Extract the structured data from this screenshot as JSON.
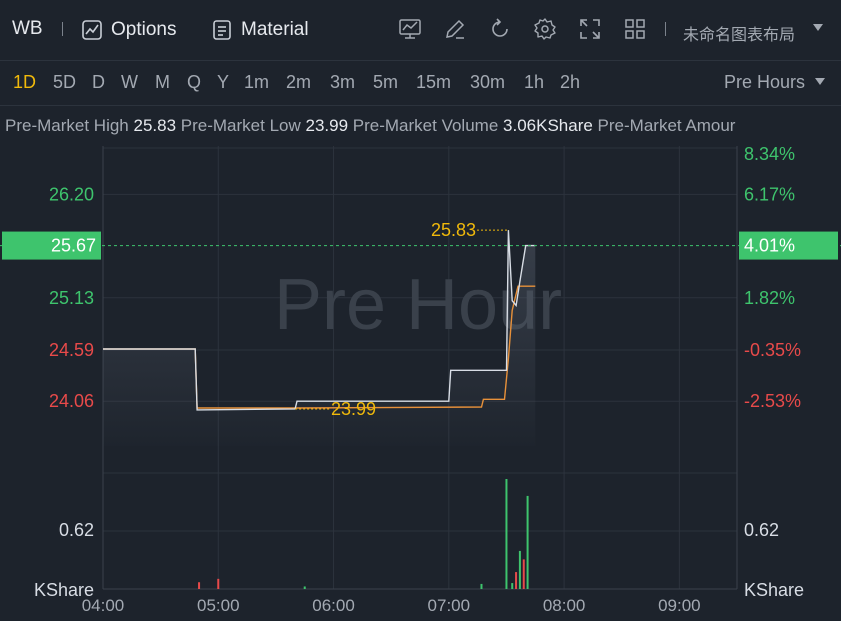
{
  "toolbar": {
    "ticker": "WB",
    "options_label": "Options",
    "material_label": "Material",
    "layout_name": "未命名图表布局",
    "icons": [
      "chart-line-icon",
      "edit-icon",
      "refresh-icon",
      "settings-icon",
      "fullscreen-icon",
      "grid-layout-icon"
    ]
  },
  "periods": [
    "1D",
    "5D",
    "D",
    "W",
    "M",
    "Q",
    "Y",
    "1m",
    "2m",
    "3m",
    "5m",
    "15m",
    "30m",
    "1h",
    "2h"
  ],
  "active_period": "1D",
  "session_label": "Pre Hours",
  "info": {
    "high_label": "Pre-Market High",
    "high_value": "25.83",
    "low_label": "Pre-Market Low",
    "low_value": "23.99",
    "volume_label": "Pre-Market Volume",
    "volume_value": "3.06KShare",
    "amount_label": "Pre-Market Amour"
  },
  "colors": {
    "up": "#3ec46d",
    "down": "#e84a4a",
    "accent": "#f0b90b",
    "price_line": "#d8dde5",
    "avg_line": "#e8913a",
    "current_tag": "#3ec46d"
  },
  "chart_data": {
    "type": "line",
    "watermark": "Pre Hour",
    "x_ticks": [
      "04:00",
      "05:00",
      "06:00",
      "07:00",
      "08:00",
      "09:00"
    ],
    "y_ticks_left": [
      "26.20",
      "25.67",
      "25.13",
      "24.59",
      "24.06"
    ],
    "y_ticks_right": [
      "8.34%",
      "6.17%",
      "4.01%",
      "1.82%",
      "-0.35%",
      "-2.53%"
    ],
    "current_price": "25.67",
    "current_change": "4.01%",
    "high_annotation": "25.83",
    "low_annotation": "23.99",
    "volume_tick": "0.62",
    "volume_unit": "KShare",
    "ylim": [
      23.7,
      26.7
    ],
    "price_series": [
      {
        "t": "04:00",
        "v": 24.6
      },
      {
        "t": "04:48",
        "v": 24.6
      },
      {
        "t": "04:49",
        "v": 23.97
      },
      {
        "t": "05:40",
        "v": 23.98
      },
      {
        "t": "05:41",
        "v": 24.06
      },
      {
        "t": "07:00",
        "v": 24.06
      },
      {
        "t": "07:01",
        "v": 24.38
      },
      {
        "t": "07:30",
        "v": 24.38
      },
      {
        "t": "07:31",
        "v": 25.83
      },
      {
        "t": "07:33",
        "v": 25.1
      },
      {
        "t": "07:35",
        "v": 25.05
      },
      {
        "t": "07:37",
        "v": 25.3
      },
      {
        "t": "07:40",
        "v": 25.67
      },
      {
        "t": "07:45",
        "v": 25.67
      }
    ],
    "avg_series": [
      {
        "t": "04:00",
        "v": 24.6
      },
      {
        "t": "04:48",
        "v": 24.6
      },
      {
        "t": "04:49",
        "v": 23.99
      },
      {
        "t": "05:40",
        "v": 23.99
      },
      {
        "t": "07:17",
        "v": 24.0
      },
      {
        "t": "07:18",
        "v": 24.08
      },
      {
        "t": "07:29",
        "v": 24.08
      },
      {
        "t": "07:31",
        "v": 24.5
      },
      {
        "t": "07:33",
        "v": 25.0
      },
      {
        "t": "07:36",
        "v": 25.25
      },
      {
        "t": "07:45",
        "v": 25.25
      }
    ],
    "volume_bars": [
      {
        "t": "04:50",
        "v": 0.08,
        "dir": "down"
      },
      {
        "t": "05:00",
        "v": 0.12,
        "dir": "down"
      },
      {
        "t": "05:45",
        "v": 0.03,
        "dir": "up"
      },
      {
        "t": "07:17",
        "v": 0.06,
        "dir": "up"
      },
      {
        "t": "07:30",
        "v": 1.3,
        "dir": "up"
      },
      {
        "t": "07:33",
        "v": 0.07,
        "dir": "up"
      },
      {
        "t": "07:35",
        "v": 0.2,
        "dir": "down"
      },
      {
        "t": "07:37",
        "v": 0.45,
        "dir": "up"
      },
      {
        "t": "07:39",
        "v": 0.35,
        "dir": "down"
      },
      {
        "t": "07:41",
        "v": 1.1,
        "dir": "up"
      }
    ]
  }
}
